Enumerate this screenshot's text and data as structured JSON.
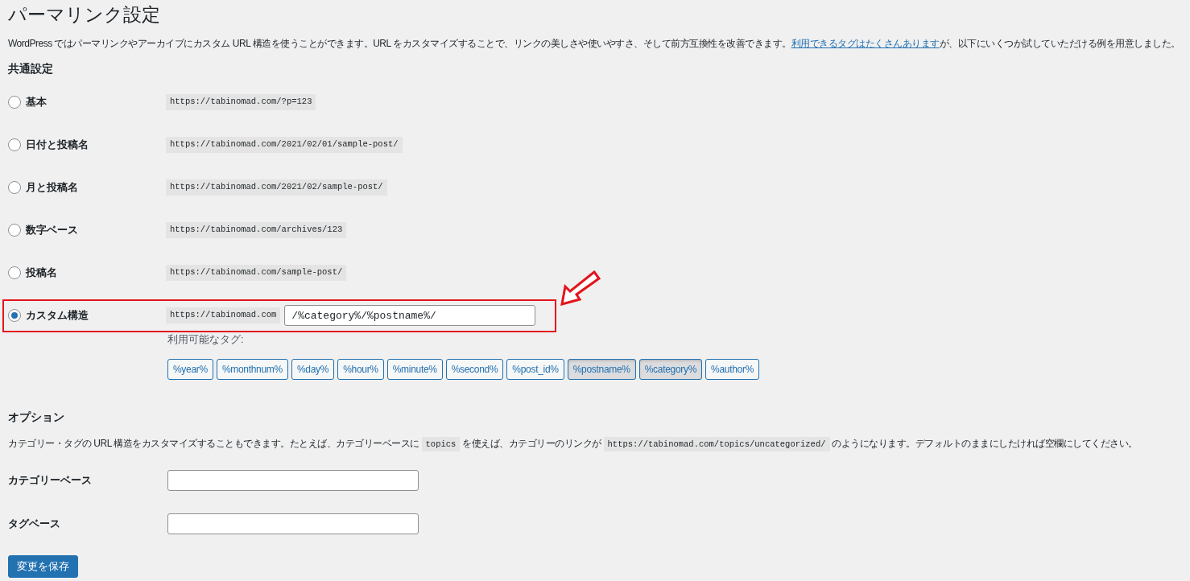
{
  "title": "パーマリンク設定",
  "intro": {
    "before": "WordPress ではパーマリンクやアーカイブにカスタム URL 構造を使うことができます。URL をカスタマイズすることで、リンクの美しさや使いやすさ、そして前方互換性を改善できます。",
    "link": "利用できるタグはたくさんあります",
    "after": "が、以下にいくつか試していただける例を用意しました。"
  },
  "common_heading": "共通設定",
  "options": [
    {
      "kind": "example",
      "label": "基本",
      "url": "https://tabinomad.com/?p=123",
      "selected": false
    },
    {
      "kind": "example",
      "label": "日付と投稿名",
      "url": "https://tabinomad.com/2021/02/01/sample-post/",
      "selected": false
    },
    {
      "kind": "example",
      "label": "月と投稿名",
      "url": "https://tabinomad.com/2021/02/sample-post/",
      "selected": false
    },
    {
      "kind": "example",
      "label": "数字ベース",
      "url": "https://tabinomad.com/archives/123",
      "selected": false
    },
    {
      "kind": "example",
      "label": "投稿名",
      "url": "https://tabinomad.com/sample-post/",
      "selected": false
    },
    {
      "kind": "custom",
      "label": "カスタム構造",
      "url": "https://tabinomad.com",
      "value": "/%category%/%postname%/",
      "selected": true,
      "highlighted": true
    }
  ],
  "tags_label": "利用可能なタグ:",
  "tags": [
    {
      "label": "%year%",
      "selected": false
    },
    {
      "label": "%monthnum%",
      "selected": false
    },
    {
      "label": "%day%",
      "selected": false
    },
    {
      "label": "%hour%",
      "selected": false
    },
    {
      "label": "%minute%",
      "selected": false
    },
    {
      "label": "%second%",
      "selected": false
    },
    {
      "label": "%post_id%",
      "selected": false
    },
    {
      "label": "%postname%",
      "selected": true
    },
    {
      "label": "%category%",
      "selected": true
    },
    {
      "label": "%author%",
      "selected": false
    }
  ],
  "options_heading": "オプション",
  "options_description": [
    {
      "kind": "text",
      "text": "カテゴリー・タグの URL 構造をカスタマイズすることもできます。たとえば、カテゴリーベースに "
    },
    {
      "kind": "code",
      "text": "topics"
    },
    {
      "kind": "text",
      "text": " を使えば、カテゴリーのリンクが "
    },
    {
      "kind": "code",
      "text": "https://tabinomad.com/topics/uncategorized/"
    },
    {
      "kind": "text",
      "text": " のようになります。デフォルトのままにしたければ空欄にしてください。"
    }
  ],
  "bases": [
    {
      "label": "カテゴリーベース"
    },
    {
      "label": "タグベース"
    }
  ],
  "save_button": "変更を保存"
}
